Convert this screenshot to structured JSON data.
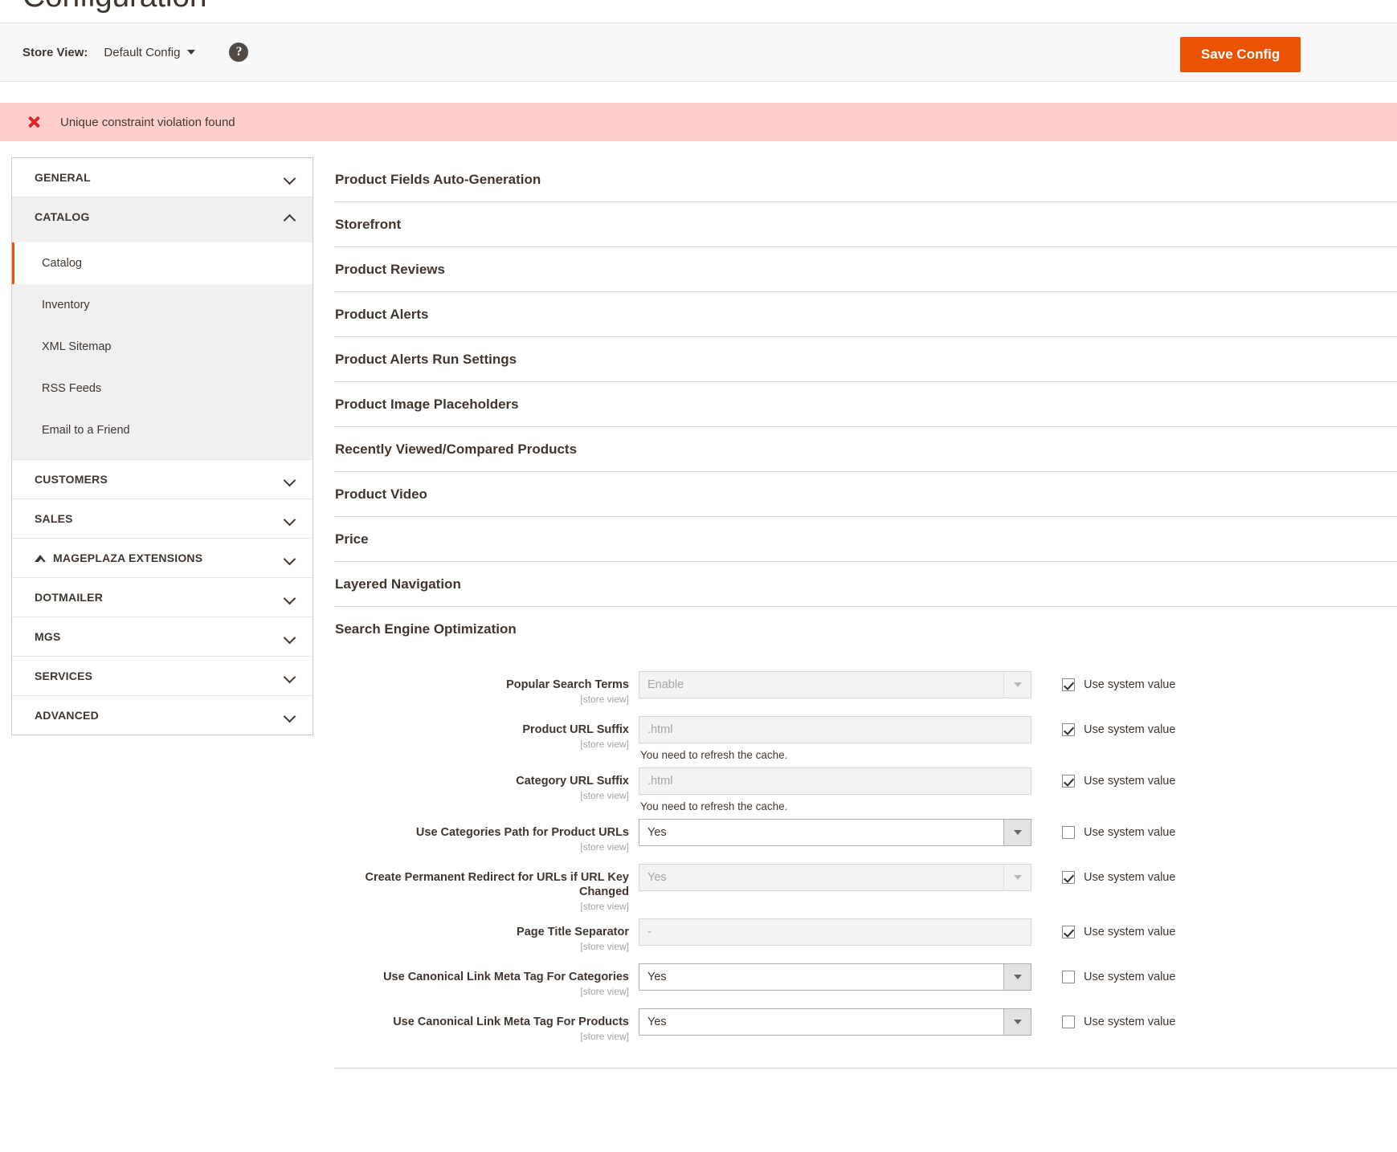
{
  "page": {
    "title": "Configuration"
  },
  "store_bar": {
    "store_view_label": "Store View:",
    "store_view_value": "Default Config",
    "help_icon_glyph": "?",
    "save_button_label": "Save Config"
  },
  "message": {
    "type": "error",
    "text": "Unique constraint violation found"
  },
  "nav": {
    "sections": [
      {
        "label": "GENERAL",
        "expanded": false,
        "has_glyph": false
      },
      {
        "label": "CATALOG",
        "expanded": true,
        "has_glyph": false,
        "items": [
          {
            "label": "Catalog",
            "current": true
          },
          {
            "label": "Inventory",
            "current": false
          },
          {
            "label": "XML Sitemap",
            "current": false
          },
          {
            "label": "RSS Feeds",
            "current": false
          },
          {
            "label": "Email to a Friend",
            "current": false
          }
        ]
      },
      {
        "label": "CUSTOMERS",
        "expanded": false,
        "has_glyph": false
      },
      {
        "label": "SALES",
        "expanded": false,
        "has_glyph": false
      },
      {
        "label": "MAGEPLAZA EXTENSIONS",
        "expanded": false,
        "has_glyph": true
      },
      {
        "label": "DOTMAILER",
        "expanded": false,
        "has_glyph": false
      },
      {
        "label": "MGS",
        "expanded": false,
        "has_glyph": false
      },
      {
        "label": "SERVICES",
        "expanded": false,
        "has_glyph": false
      },
      {
        "label": "ADVANCED",
        "expanded": false,
        "has_glyph": false
      }
    ]
  },
  "content": {
    "sections": [
      {
        "label": "Product Fields Auto-Generation",
        "open": false
      },
      {
        "label": "Storefront",
        "open": false
      },
      {
        "label": "Product Reviews",
        "open": false
      },
      {
        "label": "Product Alerts",
        "open": false
      },
      {
        "label": "Product Alerts Run Settings",
        "open": false
      },
      {
        "label": "Product Image Placeholders",
        "open": false
      },
      {
        "label": "Recently Viewed/Compared Products",
        "open": false
      },
      {
        "label": "Product Video",
        "open": false
      },
      {
        "label": "Price",
        "open": false
      },
      {
        "label": "Layered Navigation",
        "open": false
      },
      {
        "label": "Search Engine Optimization",
        "open": true
      }
    ],
    "seo_fields": [
      {
        "label": "Popular Search Terms",
        "scope": "[store view]",
        "control": "select",
        "value": "Enable",
        "disabled": true,
        "note": "",
        "use_system_label": "Use system value",
        "use_system_checked": true
      },
      {
        "label": "Product URL Suffix",
        "scope": "[store view]",
        "control": "text",
        "value": ".html",
        "disabled": true,
        "note": "You need to refresh the cache.",
        "use_system_label": "Use system value",
        "use_system_checked": true
      },
      {
        "label": "Category URL Suffix",
        "scope": "[store view]",
        "control": "text",
        "value": ".html",
        "disabled": true,
        "note": "You need to refresh the cache.",
        "use_system_label": "Use system value",
        "use_system_checked": true
      },
      {
        "label": "Use Categories Path for Product URLs",
        "scope": "[store view]",
        "control": "select",
        "value": "Yes",
        "disabled": false,
        "note": "",
        "use_system_label": "Use system value",
        "use_system_checked": false
      },
      {
        "label": "Create Permanent Redirect for URLs if URL Key Changed",
        "scope": "[store view]",
        "control": "select",
        "value": "Yes",
        "disabled": true,
        "note": "",
        "use_system_label": "Use system value",
        "use_system_checked": true
      },
      {
        "label": "Page Title Separator",
        "scope": "[store view]",
        "control": "text",
        "value": "-",
        "disabled": true,
        "note": "",
        "use_system_label": "Use system value",
        "use_system_checked": true
      },
      {
        "label": "Use Canonical Link Meta Tag For Categories",
        "scope": "[store view]",
        "control": "select",
        "value": "Yes",
        "disabled": false,
        "note": "",
        "use_system_label": "Use system value",
        "use_system_checked": false
      },
      {
        "label": "Use Canonical Link Meta Tag For Products",
        "scope": "[store view]",
        "control": "select",
        "value": "Yes",
        "disabled": false,
        "note": "",
        "use_system_label": "Use system value",
        "use_system_checked": false
      }
    ]
  },
  "colors": {
    "accent": "#eb5202",
    "error_bg": "#ffcfcc",
    "error_mark": "#e22626",
    "text": "#41362f"
  }
}
